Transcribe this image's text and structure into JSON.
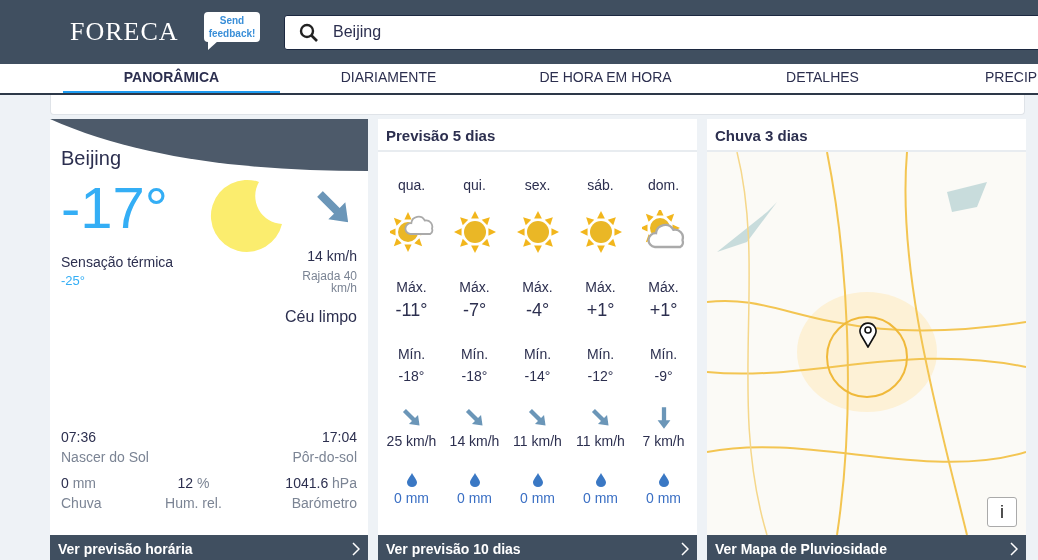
{
  "header": {
    "logo": "FORECA",
    "feedback": "Send feedback!",
    "search": {
      "value": "Beijing"
    }
  },
  "tabs": [
    {
      "label": "PANORÂMICA",
      "selected": true
    },
    {
      "label": "DIARIAMENTE",
      "selected": false
    },
    {
      "label": "DE HORA EM HORA",
      "selected": false
    },
    {
      "label": "DETALHES",
      "selected": false
    },
    {
      "label": "PRECIP",
      "selected": false
    }
  ],
  "current": {
    "location": "Beijing",
    "temperature": "-17°",
    "kind": "moon",
    "feels_like_label": "Sensação térmica",
    "feels_like": "-25°",
    "wind_arrow": {
      "kind": "nw"
    },
    "wind": "14 km/h",
    "gust": "Rajada 40 km/h",
    "condition": "Céu limpo",
    "sunrise": "07:36",
    "sunrise_label": "Nascer do Sol",
    "sunset": "17:04",
    "sunset_label": "Pôr-do-sol",
    "stats": [
      {
        "value": "0",
        "unit": "mm",
        "label": "Chuva"
      },
      {
        "value": "12",
        "unit": "%",
        "label": "Hum. rel."
      },
      {
        "value": "1041.6",
        "unit": "hPa",
        "label": "Barómetro"
      }
    ],
    "link": "Ver previsão horária"
  },
  "forecast": {
    "title": "Previsão 5 dias",
    "days": [
      {
        "day": "qua.",
        "kind": "suncloud",
        "max_label": "Máx.",
        "max": "-11°",
        "min_label": "Mín.",
        "min": "-18°",
        "wind_arrow": {
          "kind": "nw"
        },
        "wind": "25 km/h",
        "precip": "0 mm"
      },
      {
        "day": "qui.",
        "kind": "sun",
        "max_label": "Máx.",
        "max": "-7°",
        "min_label": "Mín.",
        "min": "-18°",
        "wind_arrow": {
          "kind": "nw"
        },
        "wind": "14 km/h",
        "precip": "0 mm"
      },
      {
        "day": "sex.",
        "kind": "sun",
        "max_label": "Máx.",
        "max": "-4°",
        "min_label": "Mín.",
        "min": "-14°",
        "wind_arrow": {
          "kind": "nw"
        },
        "wind": "11 km/h",
        "precip": "0 mm"
      },
      {
        "day": "sáb.",
        "kind": "sun",
        "max_label": "Máx.",
        "max": "+1°",
        "min_label": "Mín.",
        "min": "-12°",
        "wind_arrow": {
          "kind": "nw"
        },
        "wind": "11 km/h",
        "precip": "0 mm"
      },
      {
        "day": "dom.",
        "kind": "cloudy",
        "max_label": "Máx.",
        "max": "+1°",
        "min_label": "Mín.",
        "min": "-9°",
        "wind_arrow": {
          "kind": "n"
        },
        "wind": "7 km/h",
        "precip": "0 mm"
      }
    ],
    "link": "Ver previsão 10 dias"
  },
  "rain_map": {
    "title": "Chuva 3 dias",
    "info_button": "i",
    "link": "Ver Mapa de Pluviosidade"
  }
}
